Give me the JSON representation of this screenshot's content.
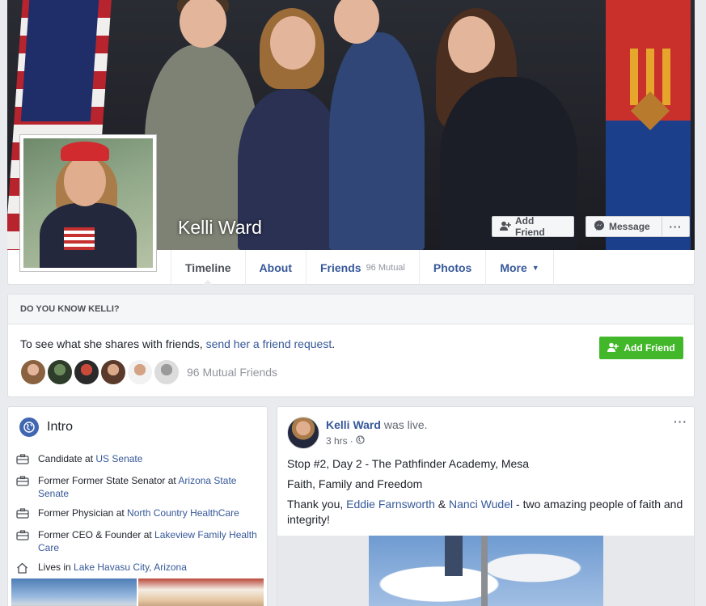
{
  "profile": {
    "name": "Kelli Ward",
    "add_friend_label": "Add Friend",
    "message_label": "Message",
    "more_dots": "···"
  },
  "tabs": [
    {
      "label": "Timeline",
      "sub": ""
    },
    {
      "label": "About",
      "sub": ""
    },
    {
      "label": "Friends",
      "sub": "96 Mutual"
    },
    {
      "label": "Photos",
      "sub": ""
    },
    {
      "label": "More",
      "sub": ""
    }
  ],
  "know": {
    "heading": "DO YOU KNOW KELLI?",
    "text_prefix": "To see what she shares with friends, ",
    "link_text": "send her a friend request",
    "text_suffix": ".",
    "button": "Add Friend",
    "mutual_label": "96 Mutual Friends"
  },
  "intro": {
    "title": "Intro",
    "items": [
      {
        "prefix": "Candidate at ",
        "link": "US Senate"
      },
      {
        "prefix": "Former Former State Senator at ",
        "link": "Arizona State Senate"
      },
      {
        "prefix": "Former Physician at ",
        "link": "North Country HealthCare"
      },
      {
        "prefix": "Former CEO & Founder at ",
        "link": "Lakeview Family Health Care"
      },
      {
        "prefix": "Lives in ",
        "link": "Lake Havasu City, Arizona"
      }
    ]
  },
  "post": {
    "author": "Kelli Ward",
    "action": " was live.",
    "time": "3 hrs",
    "dot": "·",
    "menu": "···",
    "line1": "Stop #2, Day 2 - The Pathfinder Academy, Mesa",
    "line2": "Faith, Family and Freedom",
    "line3_prefix": "Thank you, ",
    "line3_link1": "Eddie Farnsworth",
    "line3_mid": " & ",
    "line3_link2": "Nanci Wudel",
    "line3_suffix": " - two amazing people of faith and integrity!"
  },
  "colors": {
    "link": "#365899",
    "green_button": "#42b72a",
    "page_bg": "#e9ebee",
    "globe": "#4267b2"
  },
  "icons": {
    "briefcase": "briefcase-icon",
    "home": "home-icon",
    "globe": "globe-icon",
    "add_person": "add-person-icon",
    "messenger": "messenger-icon",
    "public": "public-globe-icon"
  }
}
